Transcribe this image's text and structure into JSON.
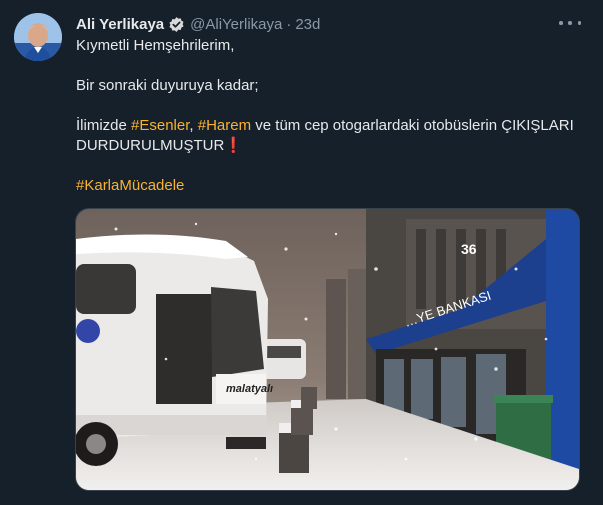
{
  "tweet": {
    "author_name": "Ali Yerlikaya",
    "handle": "@AliYerlikaya",
    "separator": "·",
    "time": "23d",
    "line1": "Kıymetli Hemşehrilerim,",
    "line2": "Bir sonraki duyuruya kadar;",
    "line3_prefix": "İlimizde ",
    "hashtag_esenler": "#Esenler",
    "comma": ", ",
    "hashtag_harem": "#Harem",
    "line3_rest": " ve tüm cep otogarlardaki otobüslerin ÇIKIŞLARI",
    "line4": "DURDURULMUŞTUR",
    "line4_emoji": "❗",
    "hashtag_karla": "#KarlaMücadele"
  },
  "media": {
    "bus_brand": "malatyalı",
    "sign_text": "…YE BANKASI",
    "sign_number": "36"
  },
  "icons": {
    "verified": "verified-badge-icon",
    "more": "more-options-icon"
  },
  "colors": {
    "background": "#15202b",
    "hashtag": "#f9b233",
    "secondary_text": "#8b98a5",
    "verified": "#1d9bf0"
  }
}
